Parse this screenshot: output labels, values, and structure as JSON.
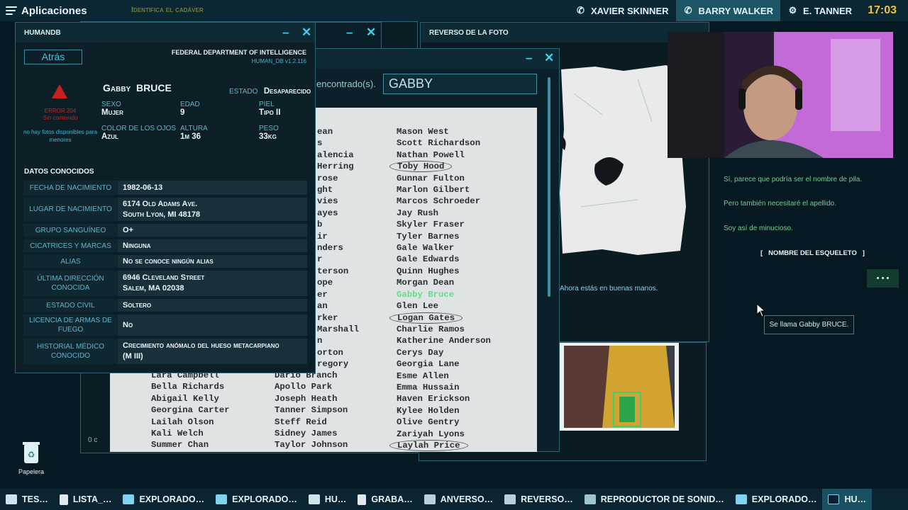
{
  "topbar": {
    "apps_label": "Aplicaciones",
    "task_title": "Identifica el cadáver",
    "contacts": [
      {
        "name": "XAVIER SKINNER",
        "icon": "phone-icon",
        "active": false
      },
      {
        "name": "BARRY WALKER",
        "icon": "phone-icon",
        "active": true
      },
      {
        "name": "E. TANNER",
        "icon": "gear-icon",
        "active": false
      }
    ],
    "clock": "17:03"
  },
  "humandb": {
    "title": "HUMANDB",
    "back": "Atrás",
    "department": "FEDERAL DEPARTMENT OF INTELLIGENCE",
    "version": "HUMAN_DB   v1.2.116",
    "error_line1": "ERROR 204",
    "error_line2": "Sin contenido",
    "no_photos": "no hay fotos disponibles para menores",
    "name_first": "Gabby",
    "name_last": "BRUCE",
    "estado_label": "ESTADO",
    "estado_value": "Desaparecido",
    "fields": {
      "sexo_label": "SEXO",
      "sexo": "Mujer",
      "edad_label": "EDAD",
      "edad": "9",
      "piel_label": "PIEL",
      "piel": "Tipo II",
      "ojos_label": "COLOR DE LOS OJOS",
      "ojos": "Azul",
      "altura_label": "ALTURA",
      "altura": "1m 36",
      "peso_label": "PESO",
      "peso": "33kg"
    },
    "known_heading": "DATOS CONOCIDOS",
    "rows": [
      {
        "k": "FECHA DE NACIMIENTO",
        "v": "1982-06-13"
      },
      {
        "k": "LUGAR DE NACIMIENTO",
        "v": "6174 Old Adams Ave.\nSouth Lyon, MI 48178"
      },
      {
        "k": "GRUPO SANGUÍNEO",
        "v": "O+"
      },
      {
        "k": "CICATRICES Y MARCAS",
        "v": "Ninguna"
      },
      {
        "k": "ALIAS",
        "v": "No se conoce ningún alias"
      },
      {
        "k": "ÚLTIMA DIRECCIÓN CONOCIDA",
        "v": "6946 Cleveland Street\nSalem, MA 02038"
      },
      {
        "k": "ESTADO CIVIL",
        "v": "Soltero"
      },
      {
        "k": "LICENCIA DE ARMAS DE FUEGO",
        "v": "No"
      },
      {
        "k": "HISTORIAL MÉDICO CONOCIDO",
        "v": "Crecimiento anómalo del hueso metacarpiano\n(M III)"
      }
    ]
  },
  "search_window": {
    "found_text": "encontrado(s).",
    "search_value": "GABBY",
    "col_left": [
      "ean",
      "s",
      "alencia",
      " Herring",
      "rose",
      "ght",
      "vies",
      "ayes",
      "b",
      "ir",
      "nders",
      "r",
      "terson",
      "ope",
      "er",
      "an",
      "rker",
      "Marshall",
      "n",
      "orton",
      "regory"
    ],
    "col_mid": [
      "Mason West",
      "Scott Richardson",
      "Nathan Powell",
      "Toby Hood",
      "Gunnar Fulton",
      "Marlon Gilbert",
      "Marcos Schroeder",
      "Jay Rush",
      "Skyler Fraser",
      "Tyler Barnes",
      "Gale Walker",
      "Gale Edwards",
      "Quinn Hughes",
      "Morgan Dean",
      "Gabby Bruce",
      "Glen Lee",
      "Logan Gates",
      "Charlie Ramos",
      "Katherine Anderson",
      "Cerys Day",
      "Georgia Lane",
      "Esme Allen",
      "Emma Hussain",
      "Haven Erickson",
      "Kylee Holden",
      "Olive Gentry",
      "Zariyah Lyons",
      "Laylah Price"
    ],
    "bottom_left": [
      "Lara Campbell",
      "Bella Richards",
      "Abigail Kelly",
      "Georgina Carter",
      "Lailah Olson",
      "Kali Welch",
      "Summer Chan"
    ],
    "bottom_mid": [
      "Dario Branch",
      "Apollo Park",
      "Joseph Heath",
      "Tanner Simpson",
      "Steff Reid",
      "Sidney James",
      "Taylor Johnson"
    ]
  },
  "photo_window": {
    "title": "REVERSO DE LA FOTO"
  },
  "chat": {
    "caption": "Ahora estás en buenas manos.",
    "messages": [
      "Sí, parece que podría ser el nombre de pila.",
      "Pero también necesitaré el apellido.",
      "Soy así de minucioso."
    ],
    "prompt": "[   NOMBRE DEL ESQUELETO   ]",
    "reply": "Se llama Gabby BRUCE.",
    "more": "• • •"
  },
  "desktop": {
    "trash_label": "Papelera",
    "size_hint": "0 c"
  },
  "taskbar": [
    {
      "label": "TES…",
      "icon": "ico-id",
      "active": false
    },
    {
      "label": "LISTA_…",
      "icon": "ico-doc",
      "active": false
    },
    {
      "label": "EXPLORADO…",
      "icon": "ico-folder",
      "active": false
    },
    {
      "label": "EXPLORADO…",
      "icon": "ico-folder",
      "active": false
    },
    {
      "label": "HU…",
      "icon": "ico-id",
      "active": false
    },
    {
      "label": "GRABA…",
      "icon": "ico-doc",
      "active": false
    },
    {
      "label": "ANVERSO…",
      "icon": "ico-img",
      "active": false
    },
    {
      "label": "REVERSO…",
      "icon": "ico-img",
      "active": false
    },
    {
      "label": "REPRODUCTOR DE SONID…",
      "icon": "ico-snd",
      "active": false
    },
    {
      "label": "EXPLORADO…",
      "icon": "ico-folder",
      "active": false
    },
    {
      "label": "HU…",
      "icon": "ico-hu",
      "active": true
    }
  ]
}
